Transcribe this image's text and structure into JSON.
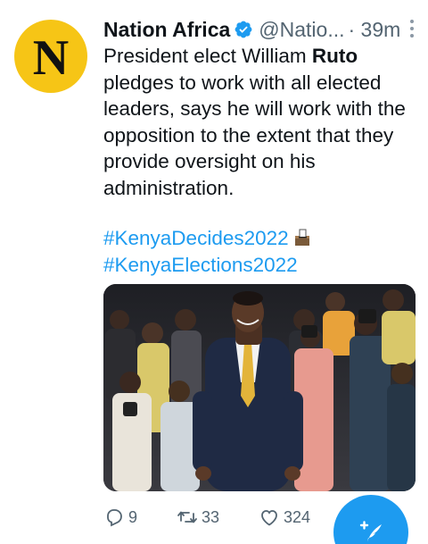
{
  "tweet": {
    "avatar_letter": "N",
    "author_name": "Nation Africa",
    "verified_icon": "verified-badge-icon",
    "handle": "@Natio...",
    "time": "· 39m",
    "text_before": "President elect William ",
    "text_bold": "Ruto",
    "text_after": " pledges to work with all elected leaders, says he will work with the opposition to the extent that they provide oversight on his administration.",
    "hashtags": [
      "#KenyaDecides2022",
      "#KenyaElections2022"
    ],
    "hashtag_color": "#1d9bf0",
    "media_icon": "ballot-box-emoji",
    "replies": "9",
    "retweets": "33",
    "likes": "324"
  },
  "colors": {
    "avatar_bg": "#f6c516",
    "fab_bg": "#1d9bf0",
    "muted_text": "#536471"
  },
  "fab": {
    "icon": "compose-feather-icon"
  }
}
